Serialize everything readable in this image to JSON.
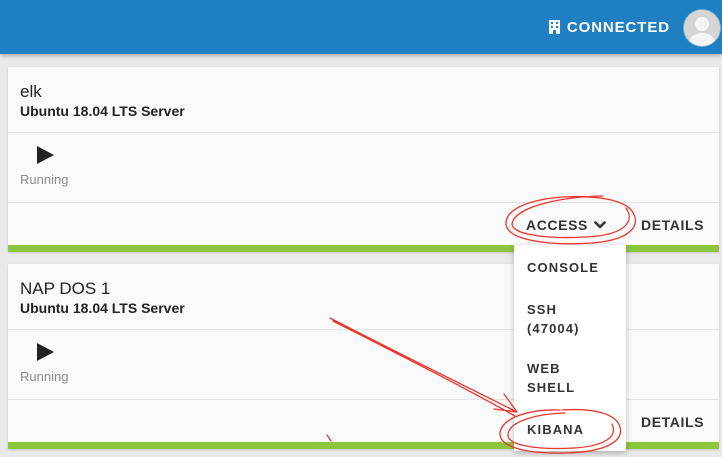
{
  "header": {
    "status_label": "CONNECTED",
    "status_icon": "building-icon",
    "avatar_icon": "user-avatar-icon",
    "bar_color": "#1f7fc2"
  },
  "machines": [
    {
      "name": "elk",
      "os": "Ubuntu 18.04 LTS Server",
      "status": "Running",
      "status_icon": "play-icon",
      "access_label": "ACCESS",
      "details_label": "DETAILS",
      "status_color": "#8cc63f"
    },
    {
      "name": "NAP DOS 1",
      "os": "Ubuntu 18.04 LTS Server",
      "status": "Running",
      "status_icon": "play-icon",
      "details_label": "DETAILS",
      "status_color": "#8cc63f"
    }
  ],
  "access_menu": {
    "items": [
      "CONSOLE",
      "SSH",
      "(47004)",
      "WEB",
      "SHELL",
      "KIBANA"
    ]
  },
  "annotation_color": "#e8372f"
}
